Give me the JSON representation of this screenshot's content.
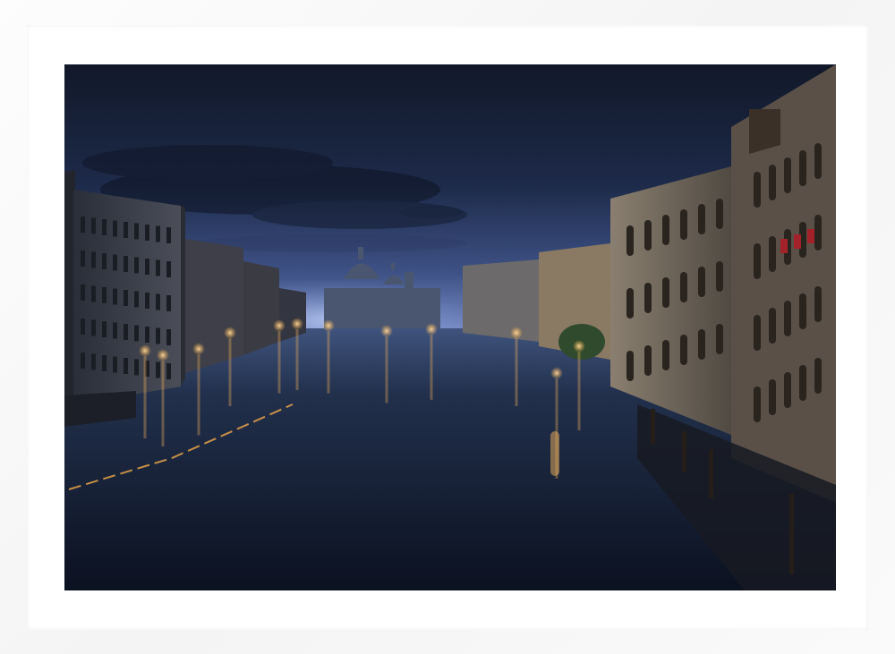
{
  "artwork": {
    "subject": "venice-grand-canal-night",
    "frame_color": "#ffffff",
    "palette": {
      "sky_top": "#131a2e",
      "sky_mid": "#26345a",
      "horizon_glow": "#6f86c2",
      "water_dark": "#0e1526",
      "water_mid": "#1e2b45",
      "light_warm": "#f3b25a",
      "light_cool": "#cfe0ff",
      "building_left": "#3b3f4a",
      "building_right": "#6a6358"
    }
  }
}
